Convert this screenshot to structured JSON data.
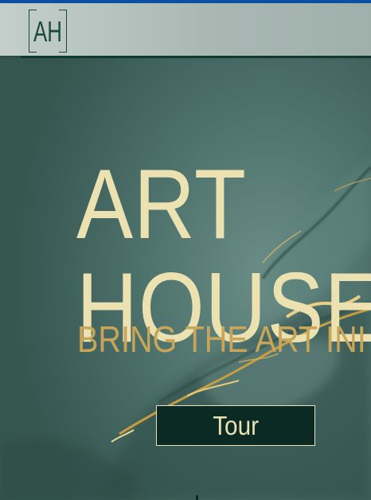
{
  "header": {
    "logo_text": "AH"
  },
  "hero": {
    "title_line_1": "ART",
    "title_line_2": "HOUSE",
    "tagline": "BRING THE ART INI",
    "cta_label": "Tour"
  },
  "colors": {
    "background": "#3c5f59",
    "title": "#ece1b0",
    "tagline": "#c9a55a",
    "button_bg": "#0c2a24",
    "header_rule": "#0f3b2f",
    "top_strip": "#0b4fa3"
  }
}
